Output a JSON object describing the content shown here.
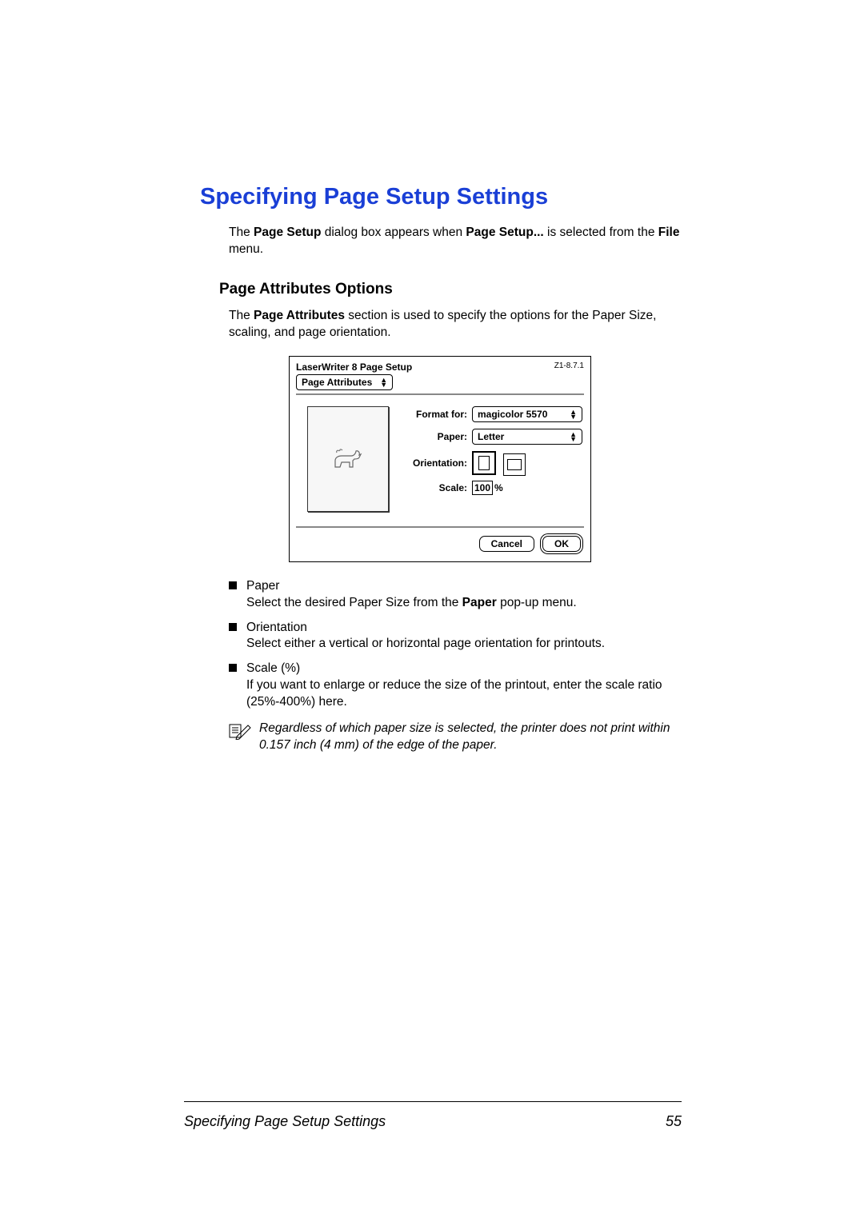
{
  "title": "Specifying Page Setup Settings",
  "intro_pre": "The ",
  "intro_b1": "Page Setup",
  "intro_mid": " dialog box appears when ",
  "intro_b2": "Page Setup...",
  "intro_post1": " is selected from the ",
  "intro_b3": "File",
  "intro_post2": " menu.",
  "subhead": "Page Attributes Options",
  "para_pre": "The ",
  "para_b": "Page Attributes",
  "para_post": " section is used to specify the options for the Paper Size, scaling, and page orientation.",
  "dialog": {
    "title": "LaserWriter 8 Page Setup",
    "version": "Z1-8.7.1",
    "tab": "Page Attributes",
    "format_label": "Format for:",
    "format_value": "magicolor 5570",
    "paper_label": "Paper:",
    "paper_value": "Letter",
    "orientation_label": "Orientation:",
    "scale_label": "Scale:",
    "scale_value": "100",
    "percent": "%",
    "cancel": "Cancel",
    "ok": "OK"
  },
  "bullets": [
    {
      "head": "Paper",
      "body_pre": "Select the desired Paper Size from the ",
      "body_b": "Paper",
      "body_post": " pop-up menu."
    },
    {
      "head": "Orientation",
      "body_pre": "Select either a vertical or horizontal page orientation for printouts.",
      "body_b": "",
      "body_post": ""
    },
    {
      "head": "Scale (%)",
      "body_pre": "If you want to enlarge or reduce the size of the printout, enter the scale ratio (25%-400%) here.",
      "body_b": "",
      "body_post": ""
    }
  ],
  "note": "Regardless of which paper size is selected, the printer does not print within 0.157 inch (4 mm) of the edge of the paper.",
  "footer_title": "Specifying Page Setup Settings",
  "footer_page": "55"
}
